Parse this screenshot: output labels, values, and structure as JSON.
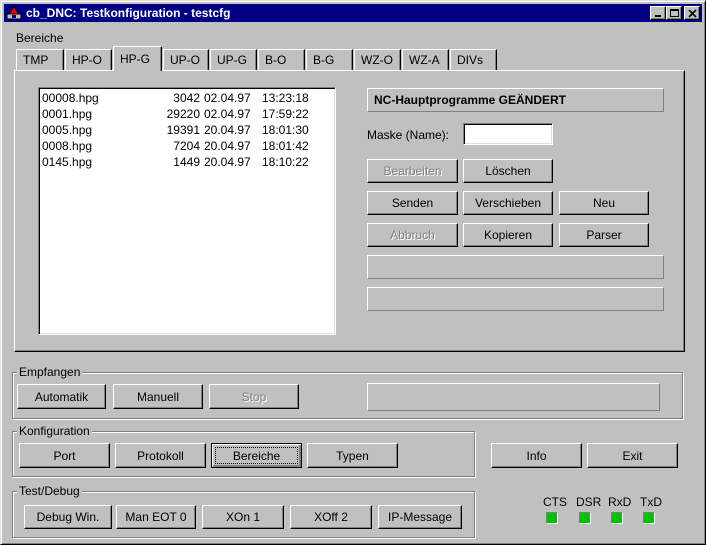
{
  "window": {
    "title": "cb_DNC: Testkonfiguration - testcfg"
  },
  "bereiche": {
    "label": "Bereiche",
    "tabs": [
      "TMP",
      "HP-O",
      "HP-G",
      "UP-O",
      "UP-G",
      "B-O",
      "B-G",
      "WZ-O",
      "WZ-A",
      "DIVs"
    ],
    "active_tab": "HP-G"
  },
  "files": [
    {
      "name": "00008.hpg",
      "size": "3042",
      "date": "02.04.97",
      "time": "13:23:18"
    },
    {
      "name": "0001.hpg",
      "size": "29220",
      "date": "02.04.97",
      "time": "17:59:22"
    },
    {
      "name": "0005.hpg",
      "size": "19391",
      "date": "20.04.97",
      "time": "18:01:30"
    },
    {
      "name": "0008.hpg",
      "size": "7204",
      "date": "20.04.97",
      "time": "18:01:42"
    },
    {
      "name": "0145.hpg",
      "size": "1449",
      "date": "20.04.97",
      "time": "18:10:22"
    }
  ],
  "panel": {
    "status_title": "NC-Hauptprogramme GEÄNDERT",
    "mask_label": "Maske (Name):",
    "mask_value": "",
    "bearbeiten": "Bearbeiten",
    "loeschen": "Löschen",
    "senden": "Senden",
    "verschieben": "Verschieben",
    "neu": "Neu",
    "abbruch": "Abbruch",
    "kopieren": "Kopieren",
    "parser": "Parser"
  },
  "empfangen": {
    "label": "Empfangen",
    "automatik": "Automatik",
    "manuell": "Manuell",
    "stop": "Stop"
  },
  "konfiguration": {
    "label": "Konfiguration",
    "port": "Port",
    "protokoll": "Protokoll",
    "bereiche": "Bereiche",
    "typen": "Typen"
  },
  "actions": {
    "info": "Info",
    "exit": "Exit"
  },
  "debug": {
    "label": "Test/Debug",
    "debug_win": "Debug Win.",
    "man_eot": "Man EOT 0",
    "xon": "XOn 1",
    "xoff": "XOff 2",
    "ip_message": "IP-Message"
  },
  "signals": {
    "cts": "CTS",
    "dsr": "DSR",
    "rxd": "RxD",
    "txd": "TxD",
    "led_color": "#00c000"
  },
  "colors": {
    "titlebar": "#000080",
    "face": "#c0c0c0"
  }
}
